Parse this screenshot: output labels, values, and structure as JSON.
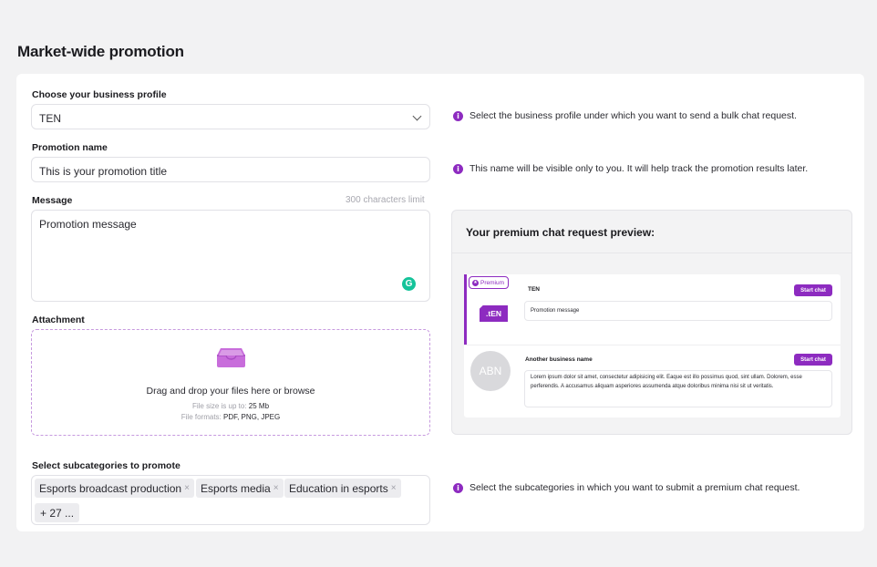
{
  "page": {
    "title": "Market-wide promotion"
  },
  "business_profile": {
    "label": "Choose your business profile",
    "value": "TEN",
    "hint": "Select the business profile under which you want to send a bulk chat request."
  },
  "promotion_name": {
    "label": "Promotion name",
    "value": "This is your promotion title",
    "hint": "This name will be visible only to you. It will help track the promotion results later."
  },
  "message": {
    "label": "Message",
    "limit": "300 characters limit",
    "value": "Promotion message",
    "grammarly_letter": "G"
  },
  "attachment": {
    "label": "Attachment",
    "drop_text": "Drag and drop your files here or browse",
    "size_prefix": "File size is up to:",
    "size_value": "25 Mb",
    "formats_prefix": "File formats:",
    "formats_value": "PDF, PNG, JPEG"
  },
  "preview": {
    "title": "Your premium chat request preview:",
    "premium_badge": "Premium",
    "first": {
      "logo": ".tEN",
      "name": "TEN",
      "button": "Start chat",
      "message": "Promotion message"
    },
    "second": {
      "avatar": "ABN",
      "name": "Another business name",
      "button": "Start chat",
      "message": "Lorem ipsum dolor sit amet, consectetur adipisicing elit. Eaque est illo possimus quod, sint ullam. Dolorem, esse perferendis. A accusamus aliquam asperiores assumenda atque doloribus minima nisi sit ut veritatis."
    }
  },
  "subcategories": {
    "label": "Select subcategories to promote",
    "tags": [
      "Esports broadcast production",
      "Esports media",
      "Education in esports"
    ],
    "more": "+ 27 ...",
    "hint": "Select the subcategories in which you want to submit a premium chat request."
  },
  "colors": {
    "accent": "#8d2bc0",
    "grammarly": "#15c39a"
  },
  "icons": {
    "info": "info-icon",
    "chevron": "chevron-down-icon",
    "tray": "inbox-tray-icon",
    "remove": "close-icon"
  }
}
